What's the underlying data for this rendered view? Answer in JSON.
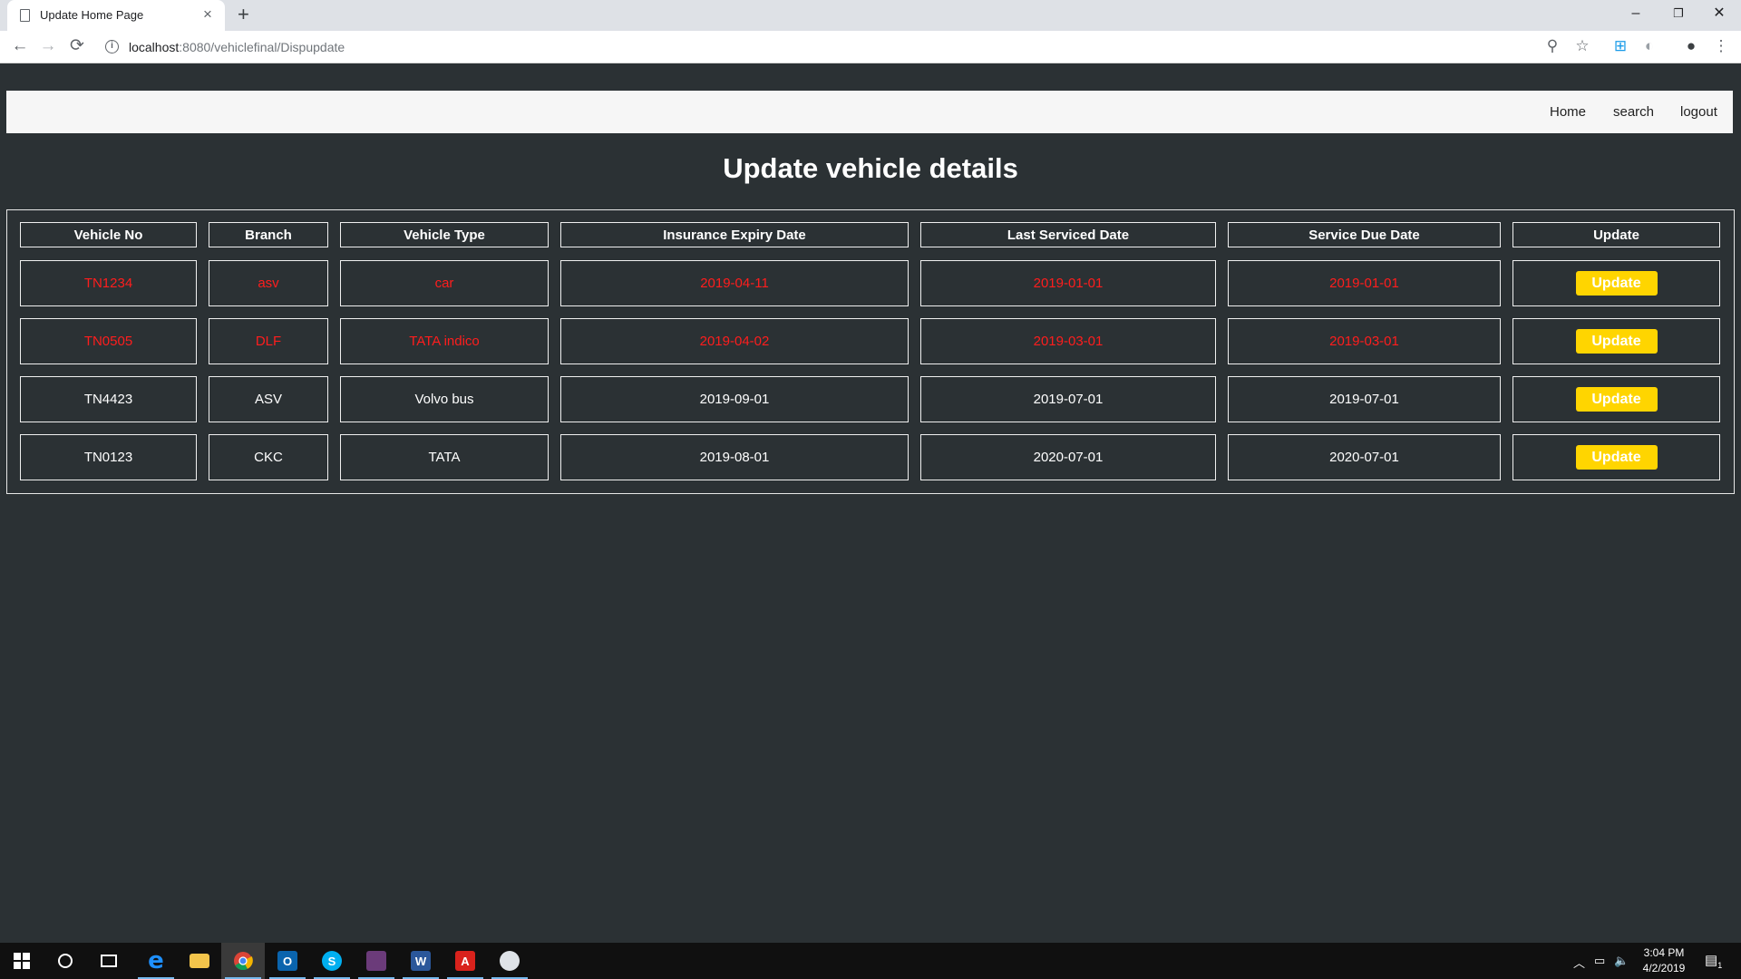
{
  "browser": {
    "tab_title": "Update Home Page",
    "tab_close": "×",
    "new_tab": "+",
    "url_host": "localhost",
    "url_path": ":8080/vehiclefinal/Dispupdate",
    "window_controls": {
      "minimize": "–",
      "restore": "❐",
      "close": "✕"
    }
  },
  "navbar": {
    "links": [
      "Home",
      "search",
      "logout"
    ]
  },
  "page": {
    "title": "Update vehicle details"
  },
  "table": {
    "headers": [
      "Vehicle No",
      "Branch",
      "Vehicle Type",
      "Insurance Expiry Date",
      "Last Serviced Date",
      "Service Due Date",
      "Update"
    ],
    "rows": [
      {
        "vehicle_no": "TN1234",
        "branch": "asv",
        "type": "car",
        "insurance_expiry": "2019-04-11",
        "last_serviced": "2019-01-01",
        "service_due": "2019-01-01",
        "action": "Update",
        "alert": true
      },
      {
        "vehicle_no": "TN0505",
        "branch": "DLF",
        "type": "TATA indico",
        "insurance_expiry": "2019-04-02",
        "last_serviced": "2019-03-01",
        "service_due": "2019-03-01",
        "action": "Update",
        "alert": true
      },
      {
        "vehicle_no": "TN4423",
        "branch": "ASV",
        "type": "Volvo bus",
        "insurance_expiry": "2019-09-01",
        "last_serviced": "2019-07-01",
        "service_due": "2019-07-01",
        "action": "Update",
        "alert": false
      },
      {
        "vehicle_no": "TN0123",
        "branch": "CKC",
        "type": "TATA",
        "insurance_expiry": "2019-08-01",
        "last_serviced": "2020-07-01",
        "service_due": "2020-07-01",
        "action": "Update",
        "alert": false
      }
    ]
  },
  "colors": {
    "page_bg": "#2b3134",
    "alert_text": "#ff1d1d",
    "button_bg": "#ffd500"
  },
  "taskbar": {
    "apps": [
      "windows-start",
      "cortana-search",
      "task-view",
      "edge",
      "file-explorer",
      "chrome",
      "outlook",
      "skype",
      "app-icon",
      "word",
      "acrobat",
      "paint"
    ],
    "clock_time": "3:04 PM",
    "clock_date": "4/2/2019",
    "notification_count": "1"
  }
}
